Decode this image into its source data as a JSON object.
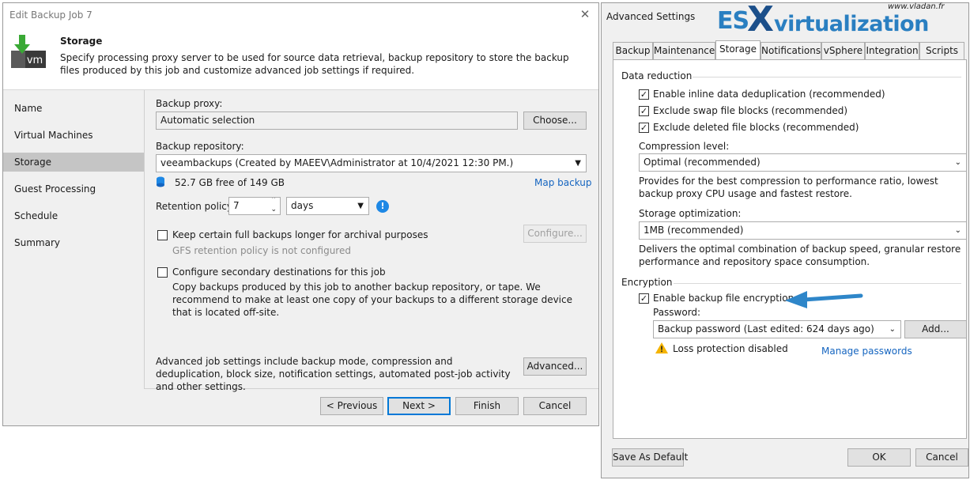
{
  "left_dialog": {
    "title": "Edit Backup Job 7",
    "header": {
      "title": "Storage",
      "description": "Specify processing proxy server to be used for source data retrieval, backup repository to store the backup files produced by this job and customize advanced job settings if required.",
      "icon_text": "vm"
    },
    "nav": [
      "Name",
      "Virtual Machines",
      "Storage",
      "Guest Processing",
      "Schedule",
      "Summary"
    ],
    "backup_proxy": {
      "label": "Backup proxy:",
      "value": "Automatic selection",
      "choose_label": "Choose..."
    },
    "backup_repository": {
      "label": "Backup repository:",
      "value": "veeambackups (Created by MAEEV\\Administrator at 10/4/2021 12:30 PM.)",
      "free_space": "52.7 GB free of 149 GB",
      "map_link": "Map backup"
    },
    "retention": {
      "label": "Retention policy:",
      "value": "7",
      "unit": "days",
      "info_icon": "!"
    },
    "gfs": {
      "label": "Keep certain full backups longer for archival purposes",
      "note": "GFS retention policy is not configured",
      "configure_label": "Configure..."
    },
    "secondary": {
      "label": "Configure secondary destinations for this job",
      "description": "Copy backups produced by this job to another backup repository, or tape. We recommend to make at least one copy of your backups to a different storage device that is located off-site."
    },
    "advanced": {
      "description": "Advanced job settings include backup mode, compression and deduplication, block size, notification settings, automated post-job activity and other settings.",
      "button_label": "Advanced..."
    },
    "footer": {
      "previous": "< Previous",
      "next": "Next >",
      "finish": "Finish",
      "cancel": "Cancel"
    }
  },
  "right_dialog": {
    "title": "Advanced Settings",
    "tabs": [
      "Backup",
      "Maintenance",
      "Storage",
      "Notifications",
      "vSphere",
      "Integration",
      "Scripts"
    ],
    "active_tab": "Storage",
    "data_reduction": {
      "group_label": "Data reduction",
      "checks": [
        "Enable inline data deduplication (recommended)",
        "Exclude swap file blocks (recommended)",
        "Exclude deleted file blocks (recommended)"
      ],
      "compression_label": "Compression level:",
      "compression_value": "Optimal (recommended)",
      "compression_desc": "Provides for the best compression to performance ratio, lowest backup proxy CPU usage and fastest restore.",
      "storage_opt_label": "Storage optimization:",
      "storage_opt_value": "1MB (recommended)",
      "storage_opt_desc": "Delivers the optimal combination of backup speed, granular restore performance and repository space consumption."
    },
    "encryption": {
      "group_label": "Encryption",
      "enable_label": "Enable backup file encryption",
      "password_label": "Password:",
      "password_value": "Backup password (Last edited: 624 days ago)",
      "add_label": "Add...",
      "warning": "Loss protection disabled",
      "manage_link": "Manage passwords"
    },
    "footer": {
      "save_default": "Save As Default",
      "ok": "OK",
      "cancel": "Cancel"
    }
  },
  "watermark": {
    "site": "www.vladan.fr",
    "es": "ES",
    "x": "X",
    "virtualization": "virtualization"
  },
  "colors": {
    "accent": "#0078d7",
    "link": "#1565c0",
    "arrow": "#2e86c9",
    "icon_green": "#3aa935"
  }
}
